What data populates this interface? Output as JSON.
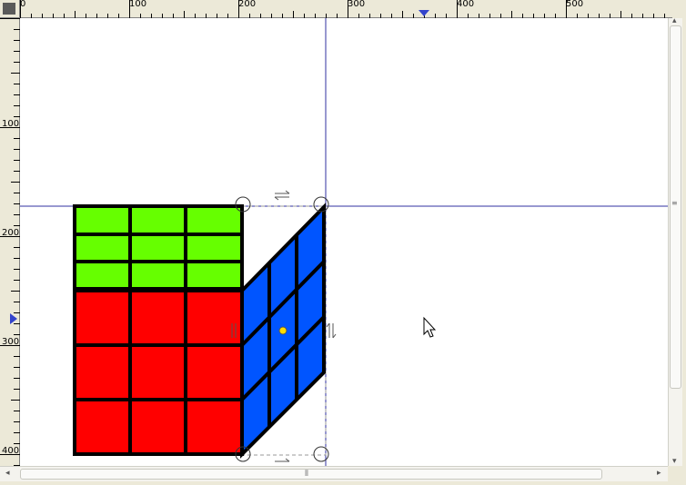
{
  "rulers": {
    "horizontal_labels": [
      "0",
      "100",
      "200",
      "300",
      "400",
      "500"
    ],
    "vertical_labels": [
      "100",
      "200",
      "300",
      "400"
    ]
  },
  "colors": {
    "top_face": "#66ff00",
    "front_face": "#ff0000",
    "side_face": "#0055ff",
    "guide": "#3030a0",
    "ruler_marker": "#3344cc"
  },
  "icons": {
    "cursor": "mouse-pointer-icon",
    "center": "rotation-center-icon",
    "handles": "rotate-handle-icon",
    "skew": "skew-arrow-icon"
  },
  "scrollbar": {
    "grip": "⦀"
  }
}
